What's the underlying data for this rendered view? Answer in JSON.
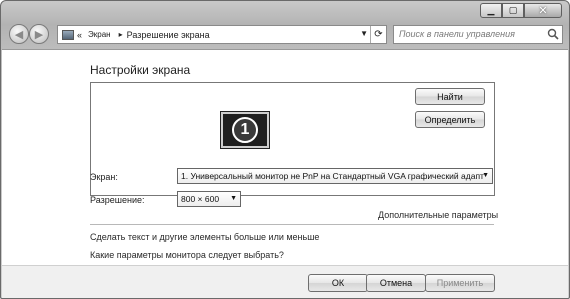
{
  "address": {
    "root_glyph": "«",
    "crumbs": [
      "Экран",
      "Разрешение экрана"
    ],
    "separator": "▸"
  },
  "search": {
    "placeholder": "Поиск в панели управления"
  },
  "settings": {
    "heading": "Настройки экрана",
    "monitor_number": "1",
    "find_button": "Найти",
    "identify_button": "Определить",
    "display_label": "Экран:",
    "display_value": "1. Универсальный монитор не PnP на Стандартный VGA графический адапт",
    "resolution_label": "Разрешение:",
    "resolution_value": "800 × 600",
    "advanced_link": "Дополнительные параметры",
    "text_size_link": "Сделать текст и другие элементы больше или меньше",
    "which_settings_link": "Какие параметры монитора следует выбрать?"
  },
  "footer": {
    "ok_button": "ОК",
    "cancel_button": "Отмена",
    "apply_button": "Применить"
  }
}
